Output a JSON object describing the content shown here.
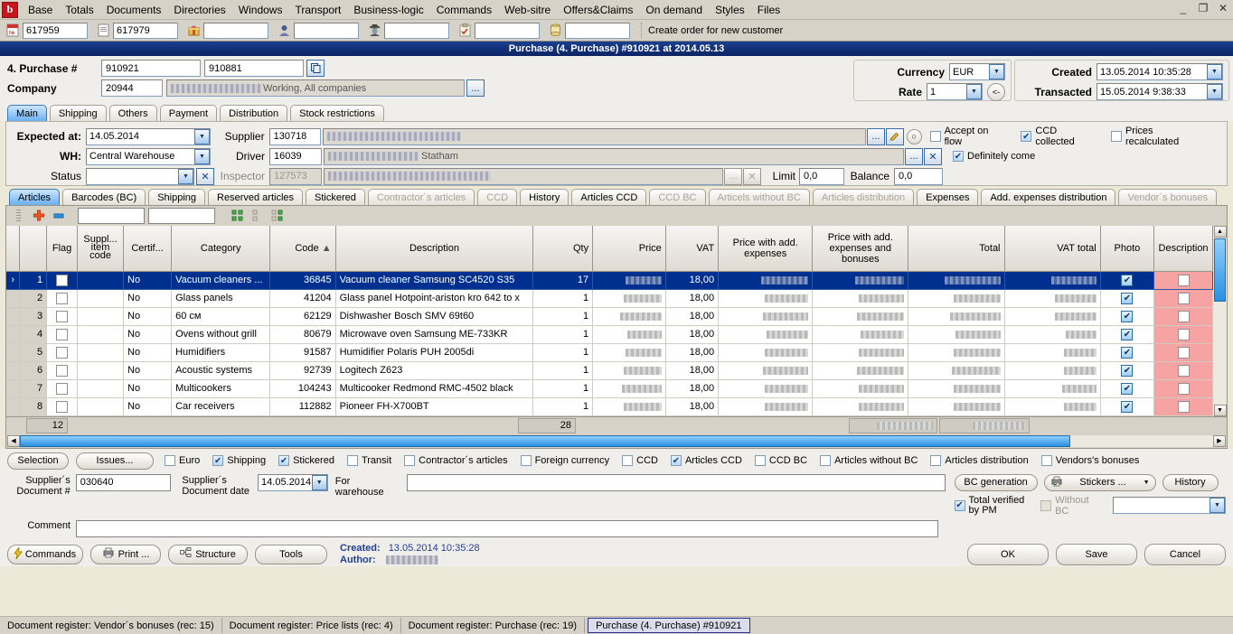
{
  "menu": {
    "logo": "b",
    "items": [
      "Base",
      "Totals",
      "Documents",
      "Directories",
      "Windows",
      "Transport",
      "Business-logic",
      "Commands",
      "Web-sitre",
      "Offers&Claims",
      "On demand",
      "Styles",
      "Files"
    ],
    "window_controls": [
      "_",
      "❐",
      "✕"
    ]
  },
  "toolbar": {
    "field1": "617959",
    "field2": "617979",
    "field3": "",
    "field4": "",
    "field5": "",
    "field6": "",
    "field7": "",
    "hint": "Create order for new customer"
  },
  "window": {
    "title": "Purchase (4. Purchase) #910921 at 2014.05.13"
  },
  "header": {
    "purchase_label": "4. Purchase #",
    "purchase_no": "910921",
    "purchase_alt_no": "910881",
    "copy_icon": "copy-icon",
    "company_label": "Company",
    "company_code": "20944",
    "company_name": "Working, All companies",
    "ellipsis": "...",
    "currency_label": "Currency",
    "currency_value": "EUR",
    "rate_label": "Rate",
    "rate_value": "1",
    "back_btn": "<-",
    "created_label": "Created",
    "created_value": "13.05.2014 10:35:28",
    "transacted_label": "Transacted",
    "transacted_value": "15.05.2014 9:38:33"
  },
  "tabs": {
    "items": [
      {
        "label": "Main",
        "active": true,
        "disabled": false
      },
      {
        "label": "Shipping",
        "active": false,
        "disabled": false
      },
      {
        "label": "Others",
        "active": false,
        "disabled": false
      },
      {
        "label": "Payment",
        "active": false,
        "disabled": false
      },
      {
        "label": "Distribution",
        "active": false,
        "disabled": false
      },
      {
        "label": "Stock restrictions",
        "active": false,
        "disabled": false
      }
    ]
  },
  "main_form": {
    "expected_label": "Expected at:",
    "expected_value": "14.05.2014",
    "wh_label": "WH:",
    "wh_value": "Central Warehouse",
    "status_label": "Status",
    "status_value": "",
    "supplier_label": "Supplier",
    "supplier_code": "130718",
    "supplier_name": "",
    "driver_label": "Driver",
    "driver_code": "16039",
    "driver_name": "Statham",
    "inspector_label": "Inspector",
    "inspector_code": "127573",
    "inspector_name": "",
    "limit_label": "Limit",
    "limit_value": "0,0",
    "balance_label": "Balance",
    "balance_value": "0,0",
    "checks": [
      {
        "label": "Accept on flow",
        "checked": false,
        "disabled": false
      },
      {
        "label": "CCD collected",
        "checked": true,
        "disabled": false
      },
      {
        "label": "Prices recalculated",
        "checked": false,
        "disabled": false
      },
      {
        "label": "Definitely come",
        "checked": true,
        "disabled": false
      }
    ]
  },
  "inner_tabs": {
    "items": [
      {
        "label": "Articles",
        "active": true,
        "disabled": false
      },
      {
        "label": "Barcodes (BC)",
        "active": false,
        "disabled": false
      },
      {
        "label": "Shipping",
        "active": false,
        "disabled": false
      },
      {
        "label": "Reserved articles",
        "active": false,
        "disabled": false
      },
      {
        "label": "Stickered",
        "active": false,
        "disabled": false
      },
      {
        "label": "Contractor´s articles",
        "active": false,
        "disabled": true
      },
      {
        "label": "CCD",
        "active": false,
        "disabled": true
      },
      {
        "label": "History",
        "active": false,
        "disabled": false
      },
      {
        "label": "Articles CCD",
        "active": false,
        "disabled": false
      },
      {
        "label": "CCD BC",
        "active": false,
        "disabled": true
      },
      {
        "label": "Articels without BC",
        "active": false,
        "disabled": true
      },
      {
        "label": "Articles distribution",
        "active": false,
        "disabled": true
      },
      {
        "label": "Expenses",
        "active": false,
        "disabled": false
      },
      {
        "label": "Add. expenses distribution",
        "active": false,
        "disabled": false
      },
      {
        "label": "Vendor´s bonuses",
        "active": false,
        "disabled": true
      }
    ]
  },
  "grid_toolbar": {
    "add_icon": "plus-icon",
    "remove_icon": "minus-icon",
    "filter1": "",
    "filter2": "",
    "expand_icon": "expand-icon",
    "collapse_icon": "collapse-icon",
    "fit-icon": "fit-columns-icon"
  },
  "table": {
    "columns": [
      {
        "key": "flag",
        "label": "Flag"
      },
      {
        "key": "suppl_item_code",
        "label": "Suppl... item code"
      },
      {
        "key": "certif",
        "label": "Certif..."
      },
      {
        "key": "category",
        "label": "Category"
      },
      {
        "key": "code",
        "label": "Code",
        "sort": "▲"
      },
      {
        "key": "description",
        "label": "Description"
      },
      {
        "key": "qty",
        "label": "Qty"
      },
      {
        "key": "price",
        "label": "Price"
      },
      {
        "key": "vat",
        "label": "VAT"
      },
      {
        "key": "price_add_exp",
        "label": "Price with add. expenses"
      },
      {
        "key": "price_add_exp_bon",
        "label": "Price with add. expenses and bonuses"
      },
      {
        "key": "total",
        "label": "Total"
      },
      {
        "key": "vat_total",
        "label": "VAT total"
      },
      {
        "key": "photo",
        "label": "Photo"
      },
      {
        "key": "desc2",
        "label": "Description"
      }
    ],
    "rows": [
      {
        "n": "1",
        "flag": false,
        "suppl": "",
        "certif": "No",
        "category": "Vacuum cleaners ...",
        "code": "36845",
        "description": "Vacuum cleaner Samsung SC4520 S35",
        "qty": "17",
        "price": "",
        "vat": "18,00",
        "price_add_exp": "",
        "price_add_exp_bon": "",
        "total": "",
        "vat_total": "",
        "photo": true,
        "desc2": false,
        "selected": true
      },
      {
        "n": "2",
        "flag": false,
        "suppl": "",
        "certif": "No",
        "category": "Glass panels",
        "code": "41204",
        "description": "Glass panel Hotpoint-ariston kro 642 to x",
        "qty": "1",
        "price": "",
        "vat": "18,00",
        "price_add_exp": "",
        "price_add_exp_bon": "",
        "total": "",
        "vat_total": "",
        "photo": true,
        "desc2": false,
        "selected": false
      },
      {
        "n": "3",
        "flag": false,
        "suppl": "",
        "certif": "No",
        "category": "60 см",
        "code": "62129",
        "description": "Dishwasher Bosch SMV 69t60",
        "qty": "1",
        "price": "",
        "vat": "18,00",
        "price_add_exp": "",
        "price_add_exp_bon": "",
        "total": "",
        "vat_total": "",
        "photo": true,
        "desc2": false,
        "selected": false
      },
      {
        "n": "4",
        "flag": false,
        "suppl": "",
        "certif": "No",
        "category": "Ovens without grill",
        "code": "80679",
        "description": "Microwave oven Samsung ME-733KR",
        "qty": "1",
        "price": "",
        "vat": "18,00",
        "price_add_exp": "",
        "price_add_exp_bon": "",
        "total": "",
        "vat_total": "",
        "photo": true,
        "desc2": false,
        "selected": false
      },
      {
        "n": "5",
        "flag": false,
        "suppl": "",
        "certif": "No",
        "category": "Humidifiers",
        "code": "91587",
        "description": "Humidifier Polaris PUH 2005di",
        "qty": "1",
        "price": "",
        "vat": "18,00",
        "price_add_exp": "",
        "price_add_exp_bon": "",
        "total": "",
        "vat_total": "",
        "photo": true,
        "desc2": false,
        "selected": false
      },
      {
        "n": "6",
        "flag": false,
        "suppl": "",
        "certif": "No",
        "category": "Acoustic systems",
        "code": "92739",
        "description": "Logitech Z623",
        "qty": "1",
        "price": "",
        "vat": "18,00",
        "price_add_exp": "",
        "price_add_exp_bon": "",
        "total": "",
        "vat_total": "",
        "photo": true,
        "desc2": false,
        "selected": false
      },
      {
        "n": "7",
        "flag": false,
        "suppl": "",
        "certif": "No",
        "category": "Multicookers",
        "code": "104243",
        "description": "Multicooker Redmond RMC-4502 black",
        "qty": "1",
        "price": "",
        "vat": "18,00",
        "price_add_exp": "",
        "price_add_exp_bon": "",
        "total": "",
        "vat_total": "",
        "photo": true,
        "desc2": false,
        "selected": false
      },
      {
        "n": "8",
        "flag": false,
        "suppl": "",
        "certif": "No",
        "category": "Car receivers",
        "code": "112882",
        "description": "Pioneer FH-X700BT",
        "qty": "1",
        "price": "",
        "vat": "18,00",
        "price_add_exp": "",
        "price_add_exp_bon": "",
        "total": "",
        "vat_total": "",
        "photo": true,
        "desc2": false,
        "selected": false
      }
    ],
    "totals": {
      "rows_count": "12",
      "qty_total": "28"
    }
  },
  "footer": {
    "selection_btn": "Selection",
    "issues_btn": "Issues...",
    "checks": [
      {
        "label": "Euro",
        "checked": false,
        "disabled": false
      },
      {
        "label": "Shipping",
        "checked": true,
        "disabled": false
      },
      {
        "label": "Stickered",
        "checked": true,
        "disabled": false
      },
      {
        "label": "Transit",
        "checked": false,
        "disabled": false
      },
      {
        "label": "Contractor´s articles",
        "checked": false,
        "disabled": false
      },
      {
        "label": "Foreign currency",
        "checked": false,
        "disabled": false
      },
      {
        "label": "CCD",
        "checked": false,
        "disabled": false
      },
      {
        "label": "Articles CCD",
        "checked": true,
        "disabled": false
      },
      {
        "label": "CCD BC",
        "checked": false,
        "disabled": false
      },
      {
        "label": "Articles without BC",
        "checked": false,
        "disabled": false
      },
      {
        "label": "Articles distribution",
        "checked": false,
        "disabled": false
      },
      {
        "label": "Vendors's bonuses",
        "checked": false,
        "disabled": false
      }
    ],
    "sup_doc_label": "Supplier´s Document #",
    "sup_doc_value": "030640",
    "sup_date_label": "Supplier´s Document date",
    "sup_date_value": "14.05.2014",
    "for_warehouse_label": "For warehouse",
    "for_warehouse_value": "",
    "comment_label": "Comment",
    "comment_value": "",
    "bc_generation_btn": "BC generation",
    "stickers_btn": "Stickers ...",
    "history_btn": "History",
    "total_verified_label": "Total verified by PM",
    "total_verified_checked": true,
    "without_bc_label": "Without BC",
    "without_bc_checked": false,
    "without_bc_combo": ""
  },
  "actionbar": {
    "commands_btn": "Commands",
    "print_btn": "Print ...",
    "structure_btn": "Structure",
    "tools_btn": "Tools",
    "created_label": "Created:",
    "created_value": "13.05.2014 10:35:28",
    "author_label": "Author:",
    "author_value": "",
    "ok_btn": "OK",
    "save_btn": "Save",
    "cancel_btn": "Cancel"
  },
  "statusbar": {
    "items": [
      "Document register: Vendor´s bonuses (rec: 15)",
      "Document register: Price lists (rec: 4)",
      "Document register: Purchase (rec: 19)"
    ],
    "active": "Purchase (4. Purchase) #910921"
  }
}
